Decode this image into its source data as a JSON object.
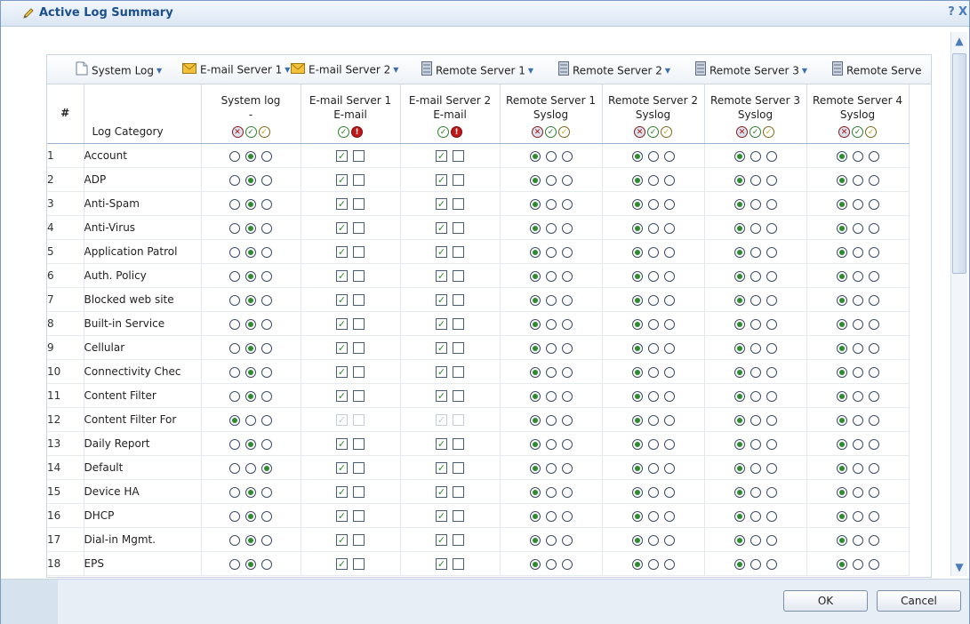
{
  "window": {
    "title": "Active Log Summary",
    "help_glyph": "?",
    "close_glyph": "X"
  },
  "toolbar": {
    "items": [
      {
        "label": "System Log",
        "icon": "document-icon"
      },
      {
        "label": "E-mail Server 1",
        "icon": "envelope-icon"
      },
      {
        "label": "E-mail Server 2",
        "icon": "envelope-icon"
      },
      {
        "label": "Remote Server 1",
        "icon": "server-icon"
      },
      {
        "label": "Remote Server 2",
        "icon": "server-icon"
      },
      {
        "label": "Remote Server 3",
        "icon": "server-icon"
      },
      {
        "label": "Remote Serve",
        "icon": "server-icon"
      }
    ]
  },
  "table": {
    "headers": {
      "index": "#",
      "category": "Log Category",
      "system_log": {
        "line1": "System log",
        "line2": "-"
      },
      "email1": {
        "line1": "E-mail Server 1",
        "line2": "E-mail"
      },
      "email2": {
        "line1": "E-mail Server 2",
        "line2": "E-mail"
      },
      "remote1": {
        "line1": "Remote Server 1",
        "line2": "Syslog"
      },
      "remote2": {
        "line1": "Remote Server 2",
        "line2": "Syslog"
      },
      "remote3": {
        "line1": "Remote Server 3",
        "line2": "Syslog"
      },
      "remote4": {
        "line1": "Remote Server 4",
        "line2": "Syslog"
      }
    },
    "rows": [
      {
        "index": "1",
        "category": "Account",
        "system_selected": 1,
        "email_disabled": false
      },
      {
        "index": "2",
        "category": "ADP",
        "system_selected": 1,
        "email_disabled": false
      },
      {
        "index": "3",
        "category": "Anti-Spam",
        "system_selected": 1,
        "email_disabled": false
      },
      {
        "index": "4",
        "category": "Anti-Virus",
        "system_selected": 1,
        "email_disabled": false
      },
      {
        "index": "5",
        "category": "Application Patrol",
        "system_selected": 1,
        "email_disabled": false
      },
      {
        "index": "6",
        "category": "Auth. Policy",
        "system_selected": 1,
        "email_disabled": false
      },
      {
        "index": "7",
        "category": "Blocked web site",
        "system_selected": 1,
        "email_disabled": false
      },
      {
        "index": "8",
        "category": "Built-in Service",
        "system_selected": 1,
        "email_disabled": false
      },
      {
        "index": "9",
        "category": "Cellular",
        "system_selected": 1,
        "email_disabled": false
      },
      {
        "index": "10",
        "category": "Connectivity Chec",
        "system_selected": 1,
        "email_disabled": false
      },
      {
        "index": "11",
        "category": "Content Filter",
        "system_selected": 1,
        "email_disabled": false
      },
      {
        "index": "12",
        "category": "Content Filter For",
        "system_selected": 0,
        "email_disabled": true
      },
      {
        "index": "13",
        "category": "Daily Report",
        "system_selected": 1,
        "email_disabled": false
      },
      {
        "index": "14",
        "category": "Default",
        "system_selected": 2,
        "email_disabled": false
      },
      {
        "index": "15",
        "category": "Device HA",
        "system_selected": 1,
        "email_disabled": false
      },
      {
        "index": "16",
        "category": "DHCP",
        "system_selected": 1,
        "email_disabled": false
      },
      {
        "index": "17",
        "category": "Dial-in Mgmt.",
        "system_selected": 1,
        "email_disabled": false
      },
      {
        "index": "18",
        "category": "EPS",
        "system_selected": 1,
        "email_disabled": false
      }
    ]
  },
  "buttons": {
    "ok": "OK",
    "cancel": "Cancel"
  },
  "colors": {
    "accent": "#1a4f8b",
    "selected_radio": "#2e8b2e",
    "alert": "#c01818"
  }
}
